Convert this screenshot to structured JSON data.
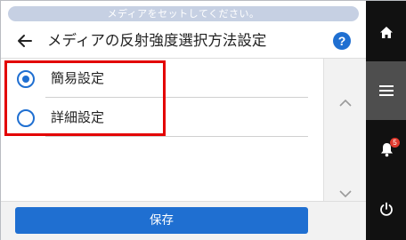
{
  "status_banner": {
    "text": "メディアをセットしてください。"
  },
  "header": {
    "back_icon": "back-arrow-icon",
    "title": "メディアの反射強度選択方法設定",
    "help_label": "?"
  },
  "options": [
    {
      "label": "簡易設定",
      "selected": true
    },
    {
      "label": "詳細設定",
      "selected": false
    }
  ],
  "scroll": {
    "up_icon": "chevron-up-icon",
    "down_icon": "chevron-down-icon"
  },
  "footer": {
    "save_label": "保存"
  },
  "sidebar": {
    "home_icon": "home-icon",
    "menu_icon": "menu-icon",
    "notification_icon": "bell-icon",
    "notification_count": "5",
    "power_icon": "power-icon"
  },
  "colors": {
    "accent": "#1f6fd1",
    "highlight": "#e30000",
    "sidebar_bg": "#111111",
    "badge": "#e23a2e"
  }
}
